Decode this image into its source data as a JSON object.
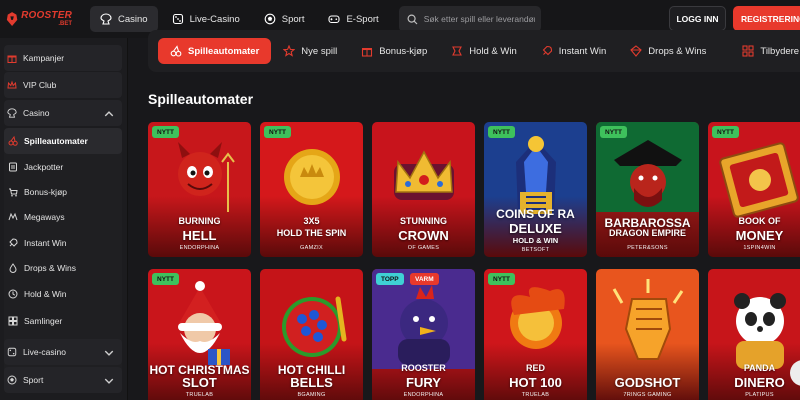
{
  "brand": {
    "name": "ROOSTER",
    "suffix": ".BET"
  },
  "nav": {
    "items": [
      {
        "label": "Casino",
        "icon": "casino-icon",
        "active": true
      },
      {
        "label": "Live-Casino",
        "icon": "live-casino-icon",
        "active": false
      },
      {
        "label": "Sport",
        "icon": "football-icon",
        "active": false
      },
      {
        "label": "E-Sport",
        "icon": "gamepad-icon",
        "active": false
      }
    ],
    "search_placeholder": "Søk etter spill eller leverandør",
    "login_label": "LOGG INN",
    "register_label": "REGISTRERING"
  },
  "sidebar": {
    "top": [
      {
        "label": "Kampanjer",
        "icon": "gift-icon"
      },
      {
        "label": "VIP Club",
        "icon": "crown-icon"
      }
    ],
    "casino_label": "Casino",
    "casino_items": [
      {
        "label": "Spilleautomater",
        "icon": "cherries-icon",
        "active": true
      },
      {
        "label": "Jackpotter",
        "icon": "jackpot-icon"
      },
      {
        "label": "Bonus-kjøp",
        "icon": "bonus-buy-icon"
      },
      {
        "label": "Megaways",
        "icon": "megaways-icon"
      },
      {
        "label": "Instant Win",
        "icon": "rocket-icon"
      },
      {
        "label": "Drops & Wins",
        "icon": "drops-wins-icon"
      },
      {
        "label": "Hold & Win",
        "icon": "hold-win-icon"
      },
      {
        "label": "Samlinger",
        "icon": "collections-icon"
      }
    ],
    "bottom": [
      {
        "label": "Live-casino",
        "icon": "live-casino-icon"
      },
      {
        "label": "Sport",
        "icon": "football-icon"
      }
    ]
  },
  "categories": [
    {
      "label": "Spilleautomater",
      "icon": "cherries-icon",
      "active": true
    },
    {
      "label": "Nye spill",
      "icon": "star-icon"
    },
    {
      "label": "Bonus-kjøp",
      "icon": "bonus-buy-icon"
    },
    {
      "label": "Hold & Win",
      "icon": "hold-win-icon"
    },
    {
      "label": "Instant Win",
      "icon": "rocket-icon"
    },
    {
      "label": "Drops & Wins",
      "icon": "drops-wins-icon"
    },
    {
      "label": "Tilbydere",
      "icon": "grid-icon"
    }
  ],
  "section_title": "Spilleautomater",
  "games": [
    {
      "badges": [
        "NYTT"
      ],
      "title1": "BURNING",
      "title2": "HELL",
      "provider": "ENDORPHINA",
      "bg": "#c7171b",
      "art": "devil"
    },
    {
      "badges": [
        "NYTT"
      ],
      "title1": "3X5",
      "title2": "HOLD THE SPIN",
      "provider": "GAMZIX",
      "bg": "#d5181b",
      "art": "coin"
    },
    {
      "badges": [],
      "title1": "STUNNING",
      "title2": "CROWN",
      "provider": "OF GAMES",
      "bg": "#c8141c",
      "art": "crown"
    },
    {
      "badges": [
        "NYTT"
      ],
      "title1": "COINS OF RA",
      "title2": "DELUXE",
      "title3": "HOLD & WIN",
      "provider": "BETSOFT",
      "bg": "#1c3f8f",
      "art": "ra"
    },
    {
      "badges": [
        "NYTT"
      ],
      "title1": "BARBAROSSA",
      "title2": "DRAGON EMPIRE",
      "provider": "PETER&SONS",
      "bg": "#9c1a18",
      "art": "pirate"
    },
    {
      "badges": [
        "NYTT"
      ],
      "title1": "BOOK OF",
      "title2": "MONEY",
      "provider": "1SPIN4WIN",
      "bg": "#c8141c",
      "art": "book"
    },
    {
      "badges": [
        "NYTT"
      ],
      "title1": "HOT CHRISTMAS",
      "title2": "SLOT",
      "provider": "TRUELAB",
      "bg": "#c9151b",
      "art": "santa"
    },
    {
      "badges": [],
      "title1": "HOT CHILLI",
      "title2": "BELLS",
      "provider": "BGAMING",
      "bg": "#c51418",
      "art": "fruit"
    },
    {
      "badges": [
        "TOPP",
        "VARM"
      ],
      "title1": "ROOSTER",
      "title2": "FURY",
      "provider": "ENDORPHINA",
      "bg": "#c8151d",
      "art": "rooster"
    },
    {
      "badges": [
        "NYTT"
      ],
      "title1": "RED",
      "title2": "HOT 100",
      "provider": "TRUELAB",
      "bg": "#cf161b",
      "art": "fireball"
    },
    {
      "badges": [],
      "title1": "",
      "title2": "GODSHOT",
      "provider": "7RINGS GAMING",
      "bg": "#e8551e",
      "art": "fist"
    },
    {
      "badges": [],
      "title1": "PANDA",
      "title2": "DINERO",
      "provider": "PLATIPUS",
      "bg": "#c7151a",
      "art": "panda"
    }
  ],
  "colors": {
    "accent": "#e8392c",
    "new_badge": "#3ec15c",
    "top_badge": "#3fd0d4"
  }
}
